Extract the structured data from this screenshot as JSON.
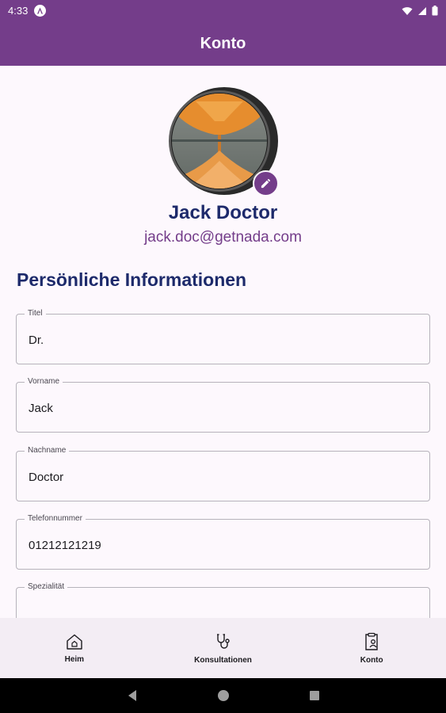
{
  "status_bar": {
    "time": "4:33",
    "icons": [
      "a-icon",
      "wifi-icon",
      "signal-icon",
      "battery-icon"
    ]
  },
  "app_bar": {
    "title": "Konto"
  },
  "profile": {
    "name": "Jack Doctor",
    "email": "jack.doc@getnada.com"
  },
  "section": {
    "title": "Persönliche Informationen"
  },
  "fields": [
    {
      "label": "Titel",
      "value": "Dr."
    },
    {
      "label": "Vorname",
      "value": "Jack"
    },
    {
      "label": "Nachname",
      "value": "Doctor"
    },
    {
      "label": "Telefonnummer",
      "value": "01212121219"
    },
    {
      "label": "Spezialität",
      "value": ""
    }
  ],
  "bottom_nav": {
    "items": [
      {
        "label": "Heim",
        "icon": "home-icon"
      },
      {
        "label": "Konsultationen",
        "icon": "stethoscope-icon"
      },
      {
        "label": "Konto",
        "icon": "account-document-icon"
      }
    ]
  },
  "colors": {
    "primary": "#743d8a",
    "heading": "#1d2a6b",
    "background": "#fdf8fd",
    "nav_background": "#f3edf4"
  }
}
